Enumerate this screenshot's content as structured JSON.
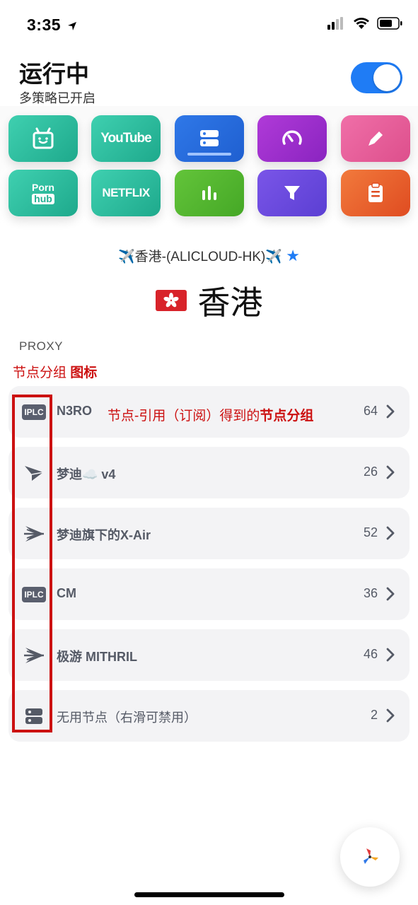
{
  "status_bar": {
    "time": "3:35"
  },
  "header": {
    "title": "运行中",
    "subtitle": "多策略已开启"
  },
  "grid": {
    "tiles": [
      {
        "name": "bilibili",
        "icon": "tv-gift-icon"
      },
      {
        "name": "YouTube",
        "label": "YouTube"
      },
      {
        "name": "server",
        "icon": "server-icon"
      },
      {
        "name": "speed",
        "icon": "speedometer-icon"
      },
      {
        "name": "edit",
        "icon": "pencil-icon"
      },
      {
        "name": "pornhub",
        "label_top": "Porn",
        "label_bottom": "hub"
      },
      {
        "name": "Netflix",
        "label": "NETFLIX"
      },
      {
        "name": "stats",
        "icon": "bar-chart-icon"
      },
      {
        "name": "filter",
        "icon": "filter-icon"
      },
      {
        "name": "clipboard",
        "icon": "clipboard-icon"
      }
    ]
  },
  "proxy": {
    "current_policy": "✈️香港-(ALICLOUD-HK)✈️",
    "region_flag": "🇭🇰",
    "region_name": "香港"
  },
  "section": {
    "label": "PROXY"
  },
  "annotations": {
    "group_icon_prefix": "节点分组 ",
    "group_icon_bold": "图标",
    "row_note_prefix": "节点-引用（订阅）得到的",
    "row_note_bold": "节点分组"
  },
  "groups": [
    {
      "label": "N3RO",
      "count": "64",
      "icon": "iplc-icon",
      "icon_text": "IPLC"
    },
    {
      "label": "梦迪☁️ v4",
      "count": "26",
      "icon": "paper-plane-icon"
    },
    {
      "label": "梦迪旗下的X-Air",
      "count": "52",
      "icon": "wing-icon"
    },
    {
      "label": "CM",
      "count": "36",
      "icon": "iplc-icon",
      "icon_text": "IPLC"
    },
    {
      "label": "极游 MITHRIL",
      "count": "46",
      "icon": "wing-icon"
    },
    {
      "label": "无用节点（右滑可禁用）",
      "count": "2",
      "icon": "server-icon"
    }
  ],
  "colors": {
    "accent": "#1f7cf5",
    "annotation": "#cc1111"
  }
}
